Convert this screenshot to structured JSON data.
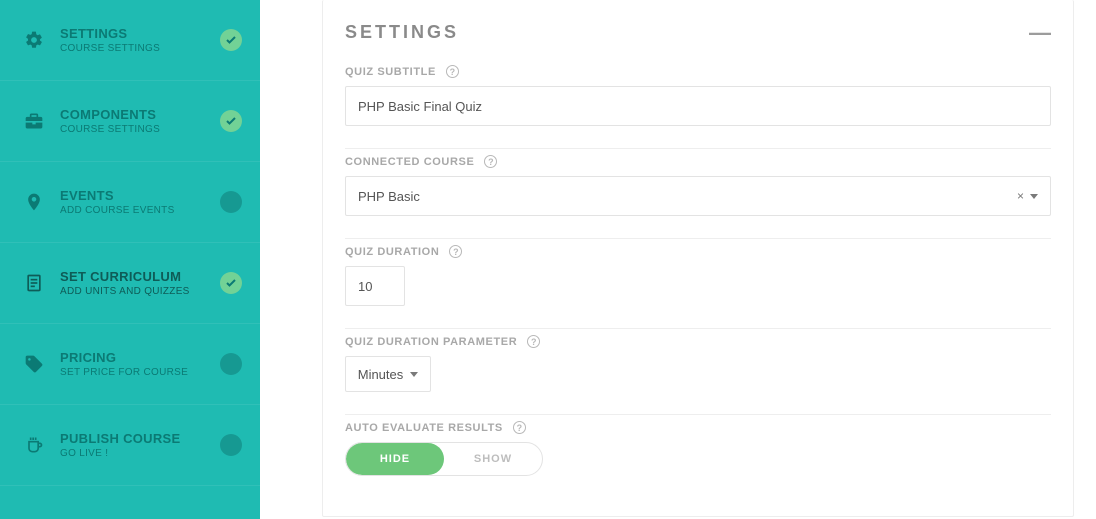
{
  "sidebar": {
    "items": [
      {
        "title": "SETTINGS",
        "sub": "COURSE SETTINGS",
        "done": true
      },
      {
        "title": "COMPONENTS",
        "sub": "COURSE SETTINGS",
        "done": true
      },
      {
        "title": "EVENTS",
        "sub": "ADD COURSE EVENTS",
        "done": false
      },
      {
        "title": "SET CURRICULUM",
        "sub": "ADD UNITS AND QUIZZES",
        "done": true
      },
      {
        "title": "PRICING",
        "sub": "SET PRICE FOR COURSE",
        "done": false
      },
      {
        "title": "PUBLISH COURSE",
        "sub": "GO LIVE !",
        "done": false
      }
    ]
  },
  "panel": {
    "title": "SETTINGS"
  },
  "fields": {
    "quiz_subtitle": {
      "label": "QUIZ SUBTITLE",
      "value": "PHP Basic Final Quiz"
    },
    "connected_course": {
      "label": "CONNECTED COURSE",
      "value": "PHP Basic",
      "clear": "×"
    },
    "quiz_duration": {
      "label": "QUIZ DURATION",
      "value": "10"
    },
    "quiz_duration_parameter": {
      "label": "QUIZ DURATION PARAMETER",
      "value": "Minutes"
    },
    "auto_evaluate": {
      "label": "AUTO EVALUATE RESULTS",
      "hide": "HIDE",
      "show": "SHOW"
    }
  }
}
